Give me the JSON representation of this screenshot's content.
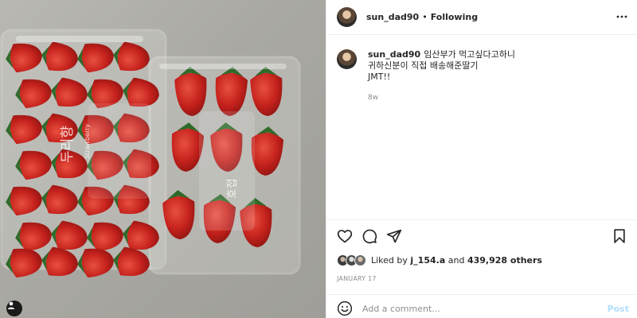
{
  "post": {
    "username": "sun_dad90",
    "separator": "•",
    "follow_status": "Following",
    "caption": {
      "line1": "임산부가 먹고싶다고하니",
      "line2": "귀하신분이 직접 배송해준딸기",
      "line3": "JMT!!",
      "age": "8w"
    },
    "photo": {
      "box_label": "두리향",
      "box_sublabel": "Strawberry",
      "box_label_2": "호접"
    },
    "likes": {
      "prefix": "Liked by ",
      "user": "j_154.a",
      "middle": " and ",
      "count": "439,928 others"
    },
    "date": "JANUARY 17",
    "comment": {
      "placeholder": "Add a comment...",
      "post_label": "Post"
    }
  },
  "icons": [
    "more-icon",
    "heart-icon",
    "comment-icon",
    "share-icon",
    "bookmark-icon",
    "emoji-icon",
    "user-tag-icon"
  ],
  "colors": {
    "post_button": "#b2dffc",
    "muted": "#8e8e8e",
    "border": "#efefef"
  }
}
